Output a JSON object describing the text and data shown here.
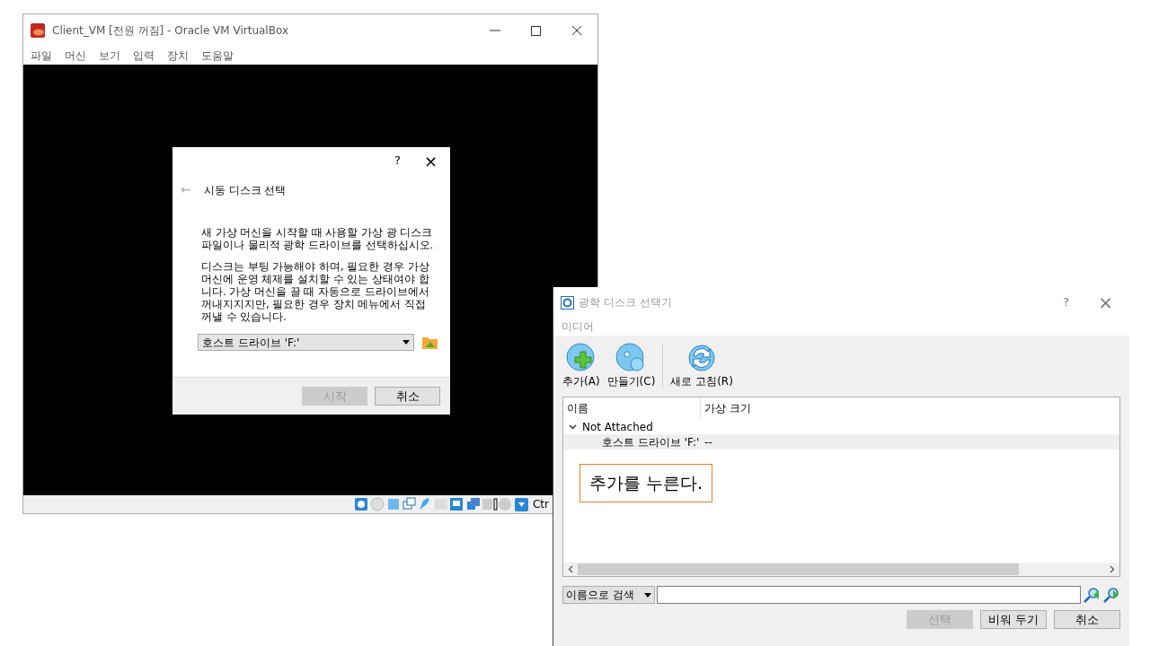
{
  "vm_window": {
    "title": "Client_VM [전원 꺼짐] - Oracle VM VirtualBox",
    "menu": [
      "파일",
      "머신",
      "보기",
      "입력",
      "장치",
      "도움말"
    ],
    "status_text": "Ctr"
  },
  "boot_dialog": {
    "help": "?",
    "close": "×",
    "back": "←",
    "heading": "시동 디스크 선택",
    "paragraphs": [
      "새 가상 머신을 시작할 때 사용할 가상 광 디스크 파일이나 물리적 광학 드라이브를 선택하십시오.",
      "디스크는 부팅 가능해야 하며, 필요한 경우 가상 머신에 운영 체제를 설치할 수 있는 상태여야 합니다. 가상 머신을 끌 때 자동으로 드라이브에서 꺼내지지지만, 필요한 경우 장치 메뉴에서 직접 꺼낼 수 있습니다."
    ],
    "drive_value": "호스트 드라이브 'F:'",
    "buttons": [
      {
        "label": "시작",
        "disabled": true
      },
      {
        "label": "취소",
        "disabled": false
      }
    ]
  },
  "selector": {
    "title": "광학 디스크 선택기",
    "help": "?",
    "close": "×",
    "menu": [
      "미디어"
    ],
    "toolbar": [
      {
        "kind": "add",
        "label": "추가(A)"
      },
      {
        "kind": "create",
        "label": "만들기(C)"
      },
      {
        "kind": "refresh",
        "label": "새로 고침(R)"
      }
    ],
    "columns": [
      "이름",
      "가상 크기"
    ],
    "groups": [
      {
        "label": "Not Attached",
        "expanded": true,
        "children": [
          {
            "name": "호스트 드라이브 'F:'",
            "size": "--",
            "selected": true
          }
        ]
      }
    ],
    "annotation": "추가를 누른다.",
    "search_mode": "이름으로 검색",
    "buttons": [
      {
        "label": "선택",
        "disabled": true
      },
      {
        "label": "비워 두기",
        "disabled": false
      },
      {
        "label": "취소",
        "disabled": false
      }
    ]
  }
}
